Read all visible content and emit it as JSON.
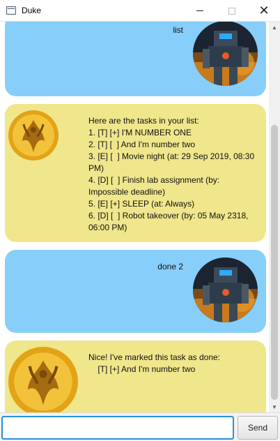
{
  "window": {
    "title": "Duke",
    "minimize_glyph": "",
    "maximize_glyph": "",
    "close_glyph": "✕"
  },
  "colors": {
    "user_bubble": "#87cefa",
    "duke_bubble": "#f0e68c",
    "input_focus_border": "#2a8fd6"
  },
  "dialog": [
    {
      "sender": "user",
      "avatar": "robot-avatar",
      "text": "list"
    },
    {
      "sender": "duke",
      "avatar": "duke-avatar",
      "text": "Here are the tasks in your list:\n1. [T] [+] I'M NUMBER ONE\n2. [T] [  ] And I'm number two\n3. [E] [  ] Movie night (at: 29 Sep 2019, 08:30\nPM)\n4. [D] [  ] Finish lab assignment (by:\nImpossible deadline)\n5. [E] [+] SLEEP (at: Always)\n6. [D] [  ] Robot takeover (by: 05 May 2318,\n06:00 PM)"
    },
    {
      "sender": "user",
      "avatar": "robot-avatar",
      "text": "done 2"
    },
    {
      "sender": "duke",
      "avatar": "duke-avatar",
      "text": "Nice! I've marked this task as done:\n    [T] [+] And I'm number two"
    }
  ],
  "input": {
    "value": "",
    "placeholder": "",
    "send_label": "Send"
  }
}
